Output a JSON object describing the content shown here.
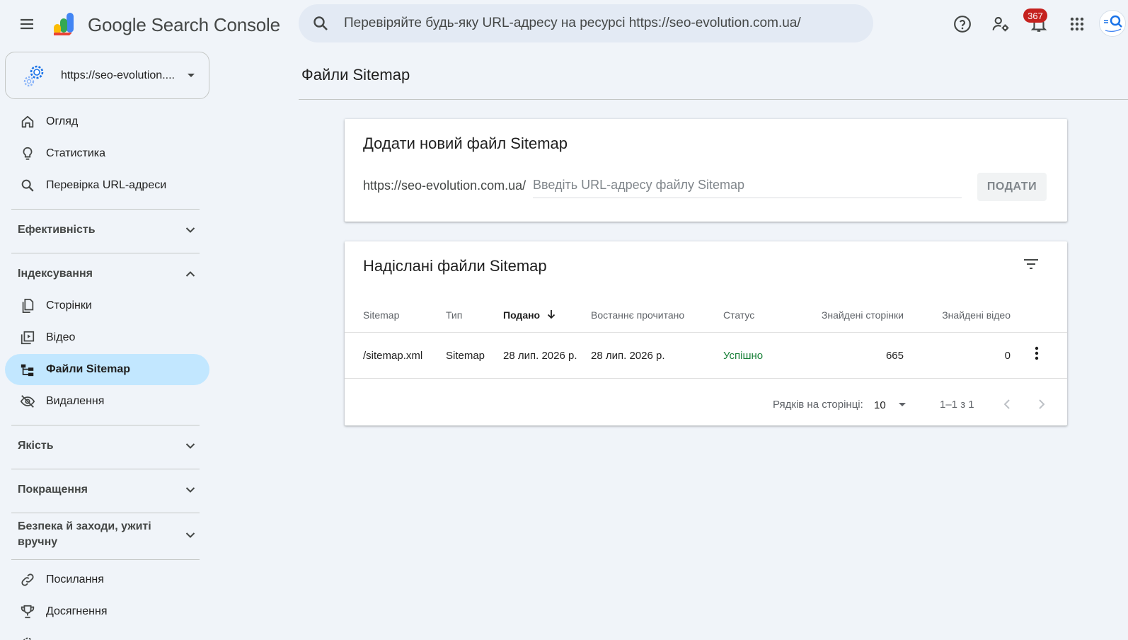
{
  "header": {
    "brand": "Google Search Console",
    "search_placeholder": "Перевіряйте будь-яку URL-адресу на ресурсі https://seo-evolution.com.ua/",
    "notifications_count": "367",
    "icons": [
      "menu-icon",
      "search-console-logo",
      "search-icon",
      "help-icon",
      "manage-users-icon",
      "notifications-icon",
      "apps-icon",
      "account-avatar"
    ]
  },
  "property": {
    "label": "https://seo-evolution...."
  },
  "sidebar": {
    "items_top": [
      {
        "label": "Огляд",
        "icon": "home-icon"
      },
      {
        "label": "Статистика",
        "icon": "lightbulb-icon"
      },
      {
        "label": "Перевірка URL-адреси",
        "icon": "search-icon"
      }
    ],
    "sections": {
      "performance": "Ефективність",
      "indexing": "Індексування",
      "quality": "Якість",
      "enhancements": "Покращення",
      "security": "Безпека й заходи, ужиті вручну"
    },
    "indexing_items": [
      {
        "label": "Сторінки",
        "icon": "pages-icon"
      },
      {
        "label": "Відео",
        "icon": "video-icon"
      },
      {
        "label": "Файли Sitemap",
        "icon": "sitemap-icon",
        "active": true
      },
      {
        "label": "Видалення",
        "icon": "removals-icon"
      }
    ],
    "items_bottom": [
      {
        "label": "Посилання",
        "icon": "link-icon"
      },
      {
        "label": "Досягнення",
        "icon": "trophy-icon"
      }
    ]
  },
  "page": {
    "title": "Файли Sitemap"
  },
  "add_card": {
    "title": "Додати новий файл Sitemap",
    "url_prefix": "https://seo-evolution.com.ua/",
    "input_placeholder": "Введіть URL-адресу файлу Sitemap",
    "submit_label": "ПОДАТИ"
  },
  "submitted_card": {
    "title": "Надіслані файли Sitemap",
    "columns": [
      "Sitemap",
      "Тип",
      "Подано",
      "Востаннє прочитано",
      "Статус",
      "Знайдені сторінки",
      "Знайдені відео"
    ],
    "rows": [
      {
        "sitemap": "/sitemap.xml",
        "type": "Sitemap",
        "submitted": "28 лип. 2026 р.",
        "last_read": "28 лип. 2026 р.",
        "status": "Успішно",
        "pages": "665",
        "videos": "0"
      }
    ],
    "pagination": {
      "rows_per_page_label": "Рядків на сторінці:",
      "rows_per_page": "10",
      "range": "1–1 з 1"
    }
  },
  "colors": {
    "background": "#f0f4f9",
    "active_nav": "#c2e7ff",
    "success": "#188038",
    "badge": "#c5221f"
  }
}
